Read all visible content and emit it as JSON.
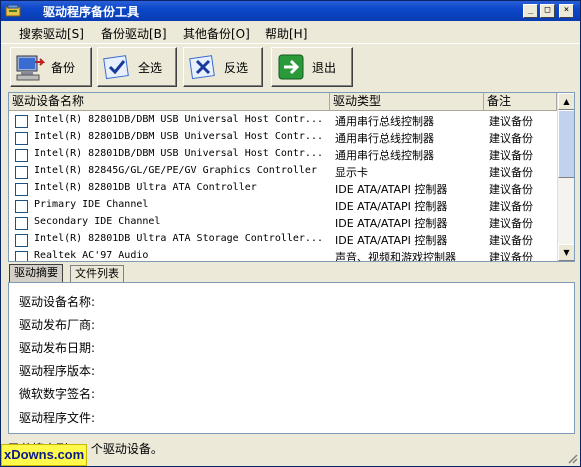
{
  "window": {
    "title": "驱动程序备份工具",
    "controls": {
      "minimize": "_",
      "maximize": "□",
      "close": "×"
    }
  },
  "menu": [
    {
      "label": "搜索驱动[S]"
    },
    {
      "label": "备份驱动[B]"
    },
    {
      "label": "其他备份[O]"
    },
    {
      "label": "帮助[H]"
    }
  ],
  "toolbar": {
    "backup_label": "备份",
    "select_all_label": "全选",
    "invert_label": "反选",
    "exit_label": "退出"
  },
  "list": {
    "columns": [
      "驱动设备名称",
      "驱动类型",
      "备注"
    ],
    "rows": [
      {
        "name": "Intel(R) 82801DB/DBM USB Universal Host Contr...",
        "type": "通用串行总线控制器",
        "note": "建议备份"
      },
      {
        "name": "Intel(R) 82801DB/DBM USB Universal Host Contr...",
        "type": "通用串行总线控制器",
        "note": "建议备份"
      },
      {
        "name": "Intel(R) 82801DB/DBM USB Universal Host Contr...",
        "type": "通用串行总线控制器",
        "note": "建议备份"
      },
      {
        "name": "Intel(R) 82845G/GL/GE/PE/GV Graphics Controller",
        "type": "显示卡",
        "note": "建议备份"
      },
      {
        "name": "Intel(R) 82801DB Ultra ATA Controller",
        "type": "IDE ATA/ATAPI 控制器",
        "note": "建议备份"
      },
      {
        "name": "Primary IDE Channel",
        "type": "IDE ATA/ATAPI 控制器",
        "note": "建议备份"
      },
      {
        "name": "Secondary IDE Channel",
        "type": "IDE ATA/ATAPI 控制器",
        "note": "建议备份"
      },
      {
        "name": "Intel(R) 82801DB Ultra ATA Storage Controller...",
        "type": "IDE ATA/ATAPI 控制器",
        "note": "建议备份"
      },
      {
        "name": "Realtek AC'97 Audio",
        "type": "声音、视频和游戏控制器",
        "note": "建议备份"
      }
    ]
  },
  "tabs": [
    {
      "label": "驱动摘要",
      "active": true
    },
    {
      "label": "文件列表",
      "active": false
    }
  ],
  "details": [
    {
      "label": "驱动设备名称:"
    },
    {
      "label": "驱动发布厂商:"
    },
    {
      "label": "驱动发布日期:"
    },
    {
      "label": "驱动程序版本:"
    },
    {
      "label": "微软数字签名:"
    },
    {
      "label": "驱动程序文件:"
    }
  ],
  "status": {
    "text": "已共搜索到 22 个驱动设备。"
  },
  "watermark": "xDowns.com",
  "colors": {
    "titlebar": "#0b47c9",
    "window_bg": "#ece9d8",
    "watermark_bg": "#fff94c"
  }
}
